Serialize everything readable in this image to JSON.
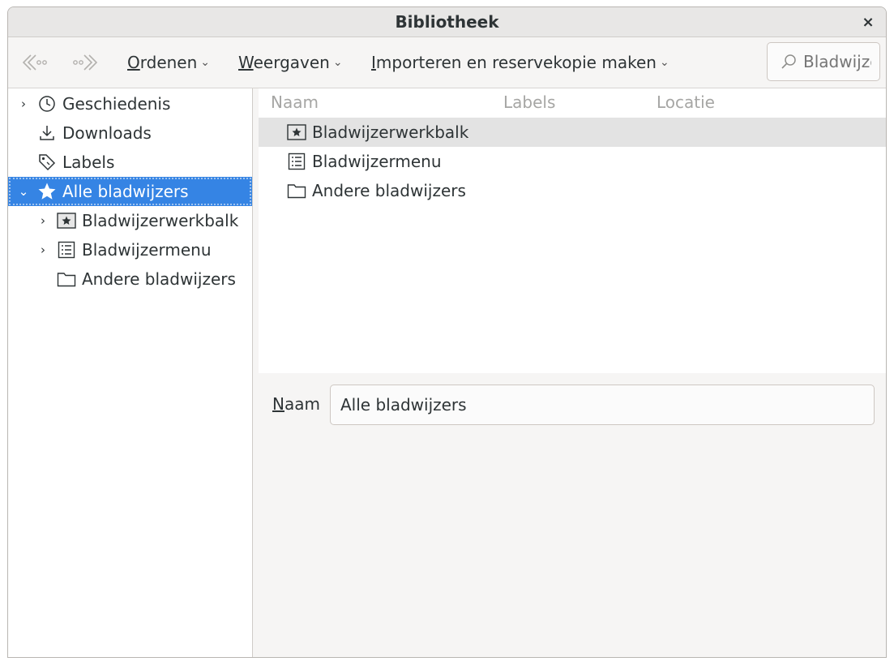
{
  "window": {
    "title": "Bibliotheek",
    "close_glyph": "×"
  },
  "toolbar": {
    "back_icon": "back-arrow-icon",
    "forward_icon": "forward-arrow-icon",
    "organize": {
      "key": "O",
      "rest": "rdenen"
    },
    "views": {
      "key": "W",
      "rest": "eergaven"
    },
    "import": {
      "key": "I",
      "rest": "mporteren en reservekopie maken"
    },
    "chevron": "⌄",
    "search_placeholder": "Bladwijzers doorzoeken"
  },
  "sidebar": {
    "items": [
      {
        "label": "Geschiedenis",
        "icon": "clock-icon",
        "twisty": "›"
      },
      {
        "label": "Downloads",
        "icon": "download-icon"
      },
      {
        "label": "Labels",
        "icon": "tag-icon"
      },
      {
        "label": "Alle bladwijzers",
        "icon": "star-icon",
        "twisty": "⌄",
        "selected": true
      },
      {
        "label": "Bladwijzerwerkbalk",
        "icon": "bookmarks-toolbar-icon",
        "twisty": "›"
      },
      {
        "label": "Bladwijzermenu",
        "icon": "bookmarks-menu-icon",
        "twisty": "›"
      },
      {
        "label": "Andere bladwijzers",
        "icon": "folder-icon"
      }
    ]
  },
  "list": {
    "columns": [
      "Naam",
      "Labels",
      "Locatie"
    ],
    "rows": [
      {
        "name": "Bladwijzerwerkbalk",
        "icon": "bookmarks-toolbar-icon"
      },
      {
        "name": "Bladwijzermenu",
        "icon": "bookmarks-menu-icon"
      },
      {
        "name": "Andere bladwijzers",
        "icon": "folder-icon"
      }
    ]
  },
  "details": {
    "name_label_key": "N",
    "name_label_rest": "aam",
    "name_value": "Alle bladwijzers"
  },
  "colors": {
    "selection": "#3584e4",
    "row_highlight": "#e3e3e3"
  }
}
